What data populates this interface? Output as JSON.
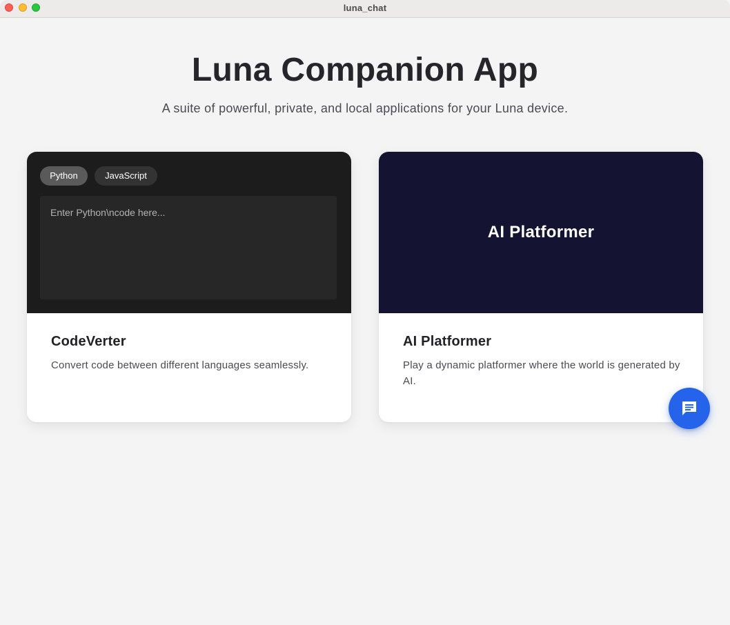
{
  "window": {
    "title": "luna_chat"
  },
  "header": {
    "title": "Luna Companion App",
    "subtitle": "A suite of powerful, private, and local applications for your Luna device."
  },
  "cards": [
    {
      "name": "CodeVerter",
      "description": "Convert code between different languages seamlessly.",
      "preview": {
        "languages": [
          "Python",
          "JavaScript"
        ],
        "selected_language": "Python",
        "code_placeholder": "Enter Python\\ncode here..."
      }
    },
    {
      "name": "AI Platformer",
      "description": "Play a dynamic platformer where the world is generated by AI.",
      "preview": {
        "title": "AI Platformer"
      }
    }
  ],
  "chat_button": {
    "icon": "chat-bubble-icon",
    "color": "#2563eb"
  },
  "colors": {
    "codeverter_preview_bg": "#1c1c1c",
    "platformer_preview_bg": "#141432",
    "page_bg": "#f4f4f5"
  }
}
